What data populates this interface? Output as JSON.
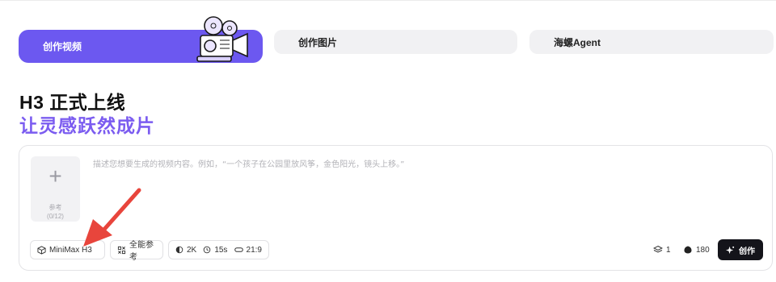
{
  "tabs": [
    {
      "id": "video",
      "label": "创作视频",
      "active": true
    },
    {
      "id": "image",
      "label": "创作图片",
      "active": false
    },
    {
      "id": "agent",
      "label": "海螺Agent",
      "active": false
    }
  ],
  "heading": {
    "line1": "H3 正式上线",
    "line2": "让灵感跃然成片"
  },
  "composer": {
    "reference": {
      "label": "参考",
      "count": "(0/12)"
    },
    "prompt_placeholder": "描述您想要生成的视频内容。例如，“一个孩子在公园里放风筝，金色阳光，镜头上移。”",
    "model": "MiniMax H3",
    "all_ref": "全能参考",
    "resolution": "2K",
    "duration": "15s",
    "aspect": "21:9",
    "stack_count": "1",
    "credits": "180",
    "create_label": "创作"
  },
  "colors": {
    "accent": "#6c58f0",
    "heading_accent": "#7b5cf0",
    "annotation": "#e8453c",
    "create_button": "#14141a"
  },
  "icons": [
    "camera-icon",
    "plus-icon",
    "cube-icon",
    "puzzle-icon",
    "half-moon-icon",
    "clock-icon",
    "ratio-icon",
    "layers-icon",
    "credit-icon",
    "sparkle-icon"
  ]
}
